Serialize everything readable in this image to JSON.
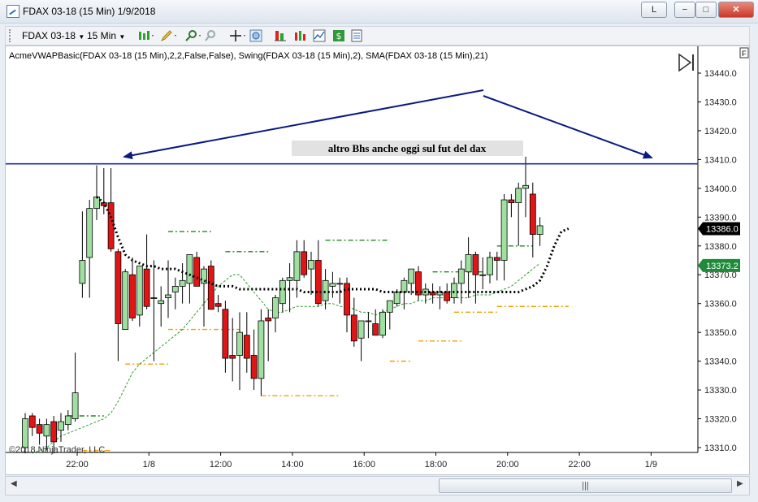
{
  "window": {
    "title": "FDAX 03-18 (15 Min)  1/9/2018",
    "buttons": {
      "restore": "L",
      "minimize": "−",
      "maximize": "□",
      "close": "✕"
    }
  },
  "toolbar": {
    "instrument": "FDAX 03-18",
    "interval": "15 Min"
  },
  "chart": {
    "indicator_label": "AcmeVWAPBasic(FDAX 03-18 (15 Min),2,2,False,False), Swing(FDAX 03-18 (15 Min),2), SMA(FDAX 03-18 (15 Min),21)",
    "annotation": "altro Bhs anche oggi sul fut del dax",
    "copyright": "©2018 NinjaTrader, LLC",
    "panel_tag": "F",
    "price_badge": "13386.0",
    "sma_badge": "13373.2",
    "y_ticks": [
      "13440.0",
      "13430.0",
      "13420.0",
      "13410.0",
      "13400.0",
      "13390.0",
      "13380.0",
      "13370.0",
      "13360.0",
      "13350.0",
      "13340.0",
      "13330.0",
      "13320.0",
      "13310.0"
    ],
    "x_ticks": [
      "22:00",
      "1/8",
      "12:00",
      "14:00",
      "16:00",
      "18:00",
      "20:00",
      "22:00",
      "1/9"
    ],
    "colors": {
      "up": "#9fe0a0",
      "down": "#e01515",
      "vwap": "#000000",
      "sma": "#2e9c2e",
      "swing_high": "#1e8a1e",
      "swing_low": "#f0a000",
      "hline": "#1a2aa8",
      "arrow": "#0a1a80",
      "badge_price": "#000000",
      "badge_sma": "#1e8a3a"
    }
  },
  "scrollbar": {
    "thumb_grip": "|||"
  },
  "chart_data": {
    "type": "candlestick",
    "ylim": [
      13306,
      13448
    ],
    "horizontal_line": 13408.5,
    "candles": [
      {
        "o": 13310,
        "h": 13322,
        "l": 13308,
        "c": 13320
      },
      {
        "o": 13321,
        "h": 13322,
        "l": 13314,
        "c": 13317
      },
      {
        "o": 13318,
        "h": 13320,
        "l": 13311,
        "c": 13315
      },
      {
        "o": 13314,
        "h": 13320,
        "l": 13309,
        "c": 13318
      },
      {
        "o": 13319,
        "h": 13321,
        "l": 13308,
        "c": 13312
      },
      {
        "o": 13316,
        "h": 13322,
        "l": 13312,
        "c": 13319
      },
      {
        "o": 13318,
        "h": 13323,
        "l": 13316,
        "c": 13321
      },
      {
        "o": 13320,
        "h": 13343,
        "l": 13319,
        "c": 13329
      },
      {
        "o": 13367,
        "h": 13392,
        "l": 13362,
        "c": 13375
      },
      {
        "o": 13376,
        "h": 13396,
        "l": 13362,
        "c": 13393
      },
      {
        "o": 13393,
        "h": 13408,
        "l": 13389,
        "c": 13397
      },
      {
        "o": 13395,
        "h": 13407,
        "l": 13391,
        "c": 13394
      },
      {
        "o": 13395,
        "h": 13407,
        "l": 13378,
        "c": 13379
      },
      {
        "o": 13378,
        "h": 13379,
        "l": 13340,
        "c": 13353
      },
      {
        "o": 13351,
        "h": 13372,
        "l": 13351,
        "c": 13371
      },
      {
        "o": 13370,
        "h": 13376,
        "l": 13354,
        "c": 13355
      },
      {
        "o": 13356,
        "h": 13373,
        "l": 13352,
        "c": 13373
      },
      {
        "o": 13372,
        "h": 13384,
        "l": 13358,
        "c": 13359
      },
      {
        "o": 13362,
        "h": 13375,
        "l": 13340,
        "c": 13362
      },
      {
        "o": 13360,
        "h": 13366,
        "l": 13352,
        "c": 13361
      },
      {
        "o": 13362,
        "h": 13375,
        "l": 13355,
        "c": 13363
      },
      {
        "o": 13364,
        "h": 13369,
        "l": 13358,
        "c": 13366
      },
      {
        "o": 13366,
        "h": 13374,
        "l": 13360,
        "c": 13368
      },
      {
        "o": 13367,
        "h": 13377,
        "l": 13360,
        "c": 13377
      },
      {
        "o": 13376,
        "h": 13378,
        "l": 13366,
        "c": 13366
      },
      {
        "o": 13367,
        "h": 13373,
        "l": 13352,
        "c": 13372
      },
      {
        "o": 13373,
        "h": 13375,
        "l": 13358,
        "c": 13358
      },
      {
        "o": 13360,
        "h": 13363,
        "l": 13357,
        "c": 13359
      },
      {
        "o": 13358,
        "h": 13361,
        "l": 13336,
        "c": 13341
      },
      {
        "o": 13342,
        "h": 13355,
        "l": 13333,
        "c": 13341
      },
      {
        "o": 13342,
        "h": 13357,
        "l": 13330,
        "c": 13350
      },
      {
        "o": 13349,
        "h": 13357,
        "l": 13336,
        "c": 13341
      },
      {
        "o": 13342,
        "h": 13351,
        "l": 13330,
        "c": 13334
      },
      {
        "o": 13334,
        "h": 13358,
        "l": 13328,
        "c": 13354
      },
      {
        "o": 13355,
        "h": 13358,
        "l": 13340,
        "c": 13354
      },
      {
        "o": 13355,
        "h": 13363,
        "l": 13350,
        "c": 13362
      },
      {
        "o": 13360,
        "h": 13369,
        "l": 13357,
        "c": 13368
      },
      {
        "o": 13368,
        "h": 13374,
        "l": 13357,
        "c": 13369
      },
      {
        "o": 13368,
        "h": 13382,
        "l": 13362,
        "c": 13378
      },
      {
        "o": 13378,
        "h": 13382,
        "l": 13369,
        "c": 13370
      },
      {
        "o": 13372,
        "h": 13378,
        "l": 13363,
        "c": 13375
      },
      {
        "o": 13375,
        "h": 13382,
        "l": 13359,
        "c": 13360
      },
      {
        "o": 13361,
        "h": 13372,
        "l": 13358,
        "c": 13368
      },
      {
        "o": 13366,
        "h": 13371,
        "l": 13362,
        "c": 13367
      },
      {
        "o": 13367,
        "h": 13369,
        "l": 13360,
        "c": 13367
      },
      {
        "o": 13367,
        "h": 13369,
        "l": 13350,
        "c": 13356
      },
      {
        "o": 13356,
        "h": 13362,
        "l": 13345,
        "c": 13347
      },
      {
        "o": 13348,
        "h": 13353,
        "l": 13340,
        "c": 13354
      },
      {
        "o": 13354,
        "h": 13357,
        "l": 13348,
        "c": 13354
      },
      {
        "o": 13353,
        "h": 13358,
        "l": 13350,
        "c": 13349
      },
      {
        "o": 13349,
        "h": 13358,
        "l": 13348,
        "c": 13357
      },
      {
        "o": 13357,
        "h": 13361,
        "l": 13351,
        "c": 13361
      },
      {
        "o": 13360,
        "h": 13365,
        "l": 13359,
        "c": 13364
      },
      {
        "o": 13364,
        "h": 13369,
        "l": 13358,
        "c": 13368
      },
      {
        "o": 13367,
        "h": 13372,
        "l": 13363,
        "c": 13372
      },
      {
        "o": 13371,
        "h": 13373,
        "l": 13361,
        "c": 13363
      },
      {
        "o": 13363,
        "h": 13367,
        "l": 13360,
        "c": 13365
      },
      {
        "o": 13364,
        "h": 13367,
        "l": 13360,
        "c": 13363
      },
      {
        "o": 13363,
        "h": 13366,
        "l": 13358,
        "c": 13364
      },
      {
        "o": 13364,
        "h": 13367,
        "l": 13360,
        "c": 13361
      },
      {
        "o": 13362,
        "h": 13369,
        "l": 13360,
        "c": 13367
      },
      {
        "o": 13367,
        "h": 13375,
        "l": 13360,
        "c": 13372
      },
      {
        "o": 13371,
        "h": 13383,
        "l": 13362,
        "c": 13377
      },
      {
        "o": 13377,
        "h": 13378,
        "l": 13360,
        "c": 13370
      },
      {
        "o": 13370,
        "h": 13376,
        "l": 13365,
        "c": 13370
      },
      {
        "o": 13370,
        "h": 13378,
        "l": 13367,
        "c": 13376
      },
      {
        "o": 13376,
        "h": 13378,
        "l": 13368,
        "c": 13375
      },
      {
        "o": 13375,
        "h": 13398,
        "l": 13368,
        "c": 13396
      },
      {
        "o": 13396,
        "h": 13398,
        "l": 13390,
        "c": 13395
      },
      {
        "o": 13395,
        "h": 13402,
        "l": 13380,
        "c": 13400
      },
      {
        "o": 13400,
        "h": 13411,
        "l": 13390,
        "c": 13401
      },
      {
        "o": 13398,
        "h": 13402,
        "l": 13376,
        "c": 13384
      },
      {
        "o": 13384,
        "h": 13390,
        "l": 13380,
        "c": 13387
      }
    ],
    "vwap": [
      13397,
      13395,
      13390,
      13383,
      13377,
      13375,
      13374,
      13373,
      13373,
      13372,
      13372,
      13372,
      13371,
      13370,
      13369,
      13368,
      13367,
      13366,
      13366,
      13366,
      13365,
      13365,
      13365,
      13365,
      13365,
      13365,
      13365,
      13365,
      13365,
      13364,
      13364,
      13364,
      13364,
      13364,
      13364,
      13365,
      13365,
      13365,
      13365,
      13365,
      13364,
      13364,
      13364,
      13364,
      13364,
      13364,
      13364,
      13364,
      13364,
      13364,
      13364,
      13364,
      13364,
      13364,
      13364,
      13364,
      13364,
      13364,
      13364,
      13364,
      13365,
      13366,
      13368,
      13373,
      13380,
      13385,
      13386
    ],
    "sma": [
      13308,
      13309,
      13310,
      13312,
      13314,
      13315,
      13316,
      13317,
      13318,
      13319,
      13320,
      13322,
      13326,
      13331,
      13336,
      13339,
      13341,
      13343,
      13345,
      13347,
      13349,
      13351,
      13354,
      13357,
      13360,
      13363,
      13366,
      13368,
      13370,
      13370,
      13367,
      13364,
      13361,
      13358,
      13357,
      13357,
      13358,
      13359,
      13359,
      13359,
      13359,
      13360,
      13360,
      13359,
      13359,
      13358,
      13357,
      13357,
      13356,
      13357,
      13358,
      13359,
      13360,
      13360,
      13361,
      13361,
      13362,
      13362,
      13362,
      13362,
      13362,
      13362,
      13363,
      13363,
      13363,
      13364,
      13365,
      13366,
      13368,
      13370,
      13372,
      13374
    ],
    "swing_highs": [
      {
        "price": 13321,
        "from": 6,
        "to": 11
      },
      {
        "price": 13408.5,
        "from": 11,
        "to": 16
      },
      {
        "price": 13385,
        "from": 20,
        "to": 26
      },
      {
        "price": 13378,
        "from": 28,
        "to": 34
      },
      {
        "price": 13382,
        "from": 42,
        "to": 51
      },
      {
        "price": 13371,
        "from": 57,
        "to": 64
      },
      {
        "price": 13380,
        "from": 66,
        "to": 71
      }
    ],
    "swing_lows": [
      {
        "price": 13309,
        "from": 8,
        "to": 12
      },
      {
        "price": 13339,
        "from": 14,
        "to": 20
      },
      {
        "price": 13351,
        "from": 20,
        "to": 30
      },
      {
        "price": 13328,
        "from": 33,
        "to": 44
      },
      {
        "price": 13340,
        "from": 51,
        "to": 54
      },
      {
        "price": 13347,
        "from": 55,
        "to": 61
      },
      {
        "price": 13357,
        "from": 60,
        "to": 66
      },
      {
        "price": 13359,
        "from": 66,
        "to": 76
      }
    ]
  }
}
